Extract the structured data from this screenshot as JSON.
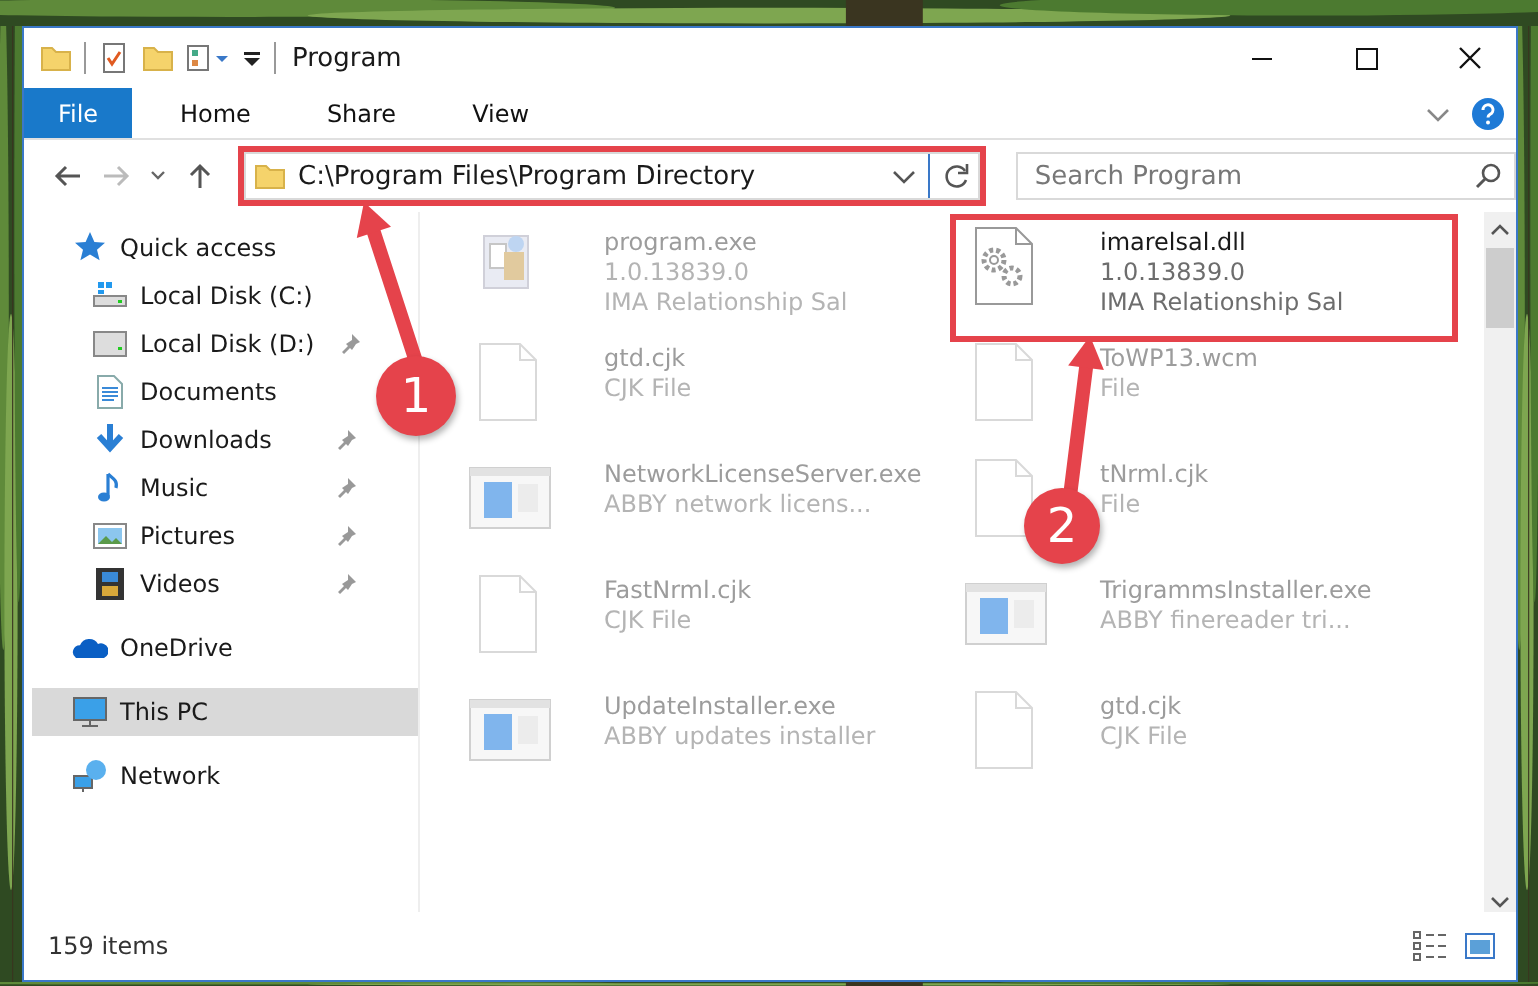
{
  "window": {
    "title": "Program"
  },
  "ribbon": {
    "tabs": [
      {
        "label": "File",
        "kind": "file",
        "selected": false
      },
      {
        "label": "Home",
        "kind": "tab",
        "selected": false
      },
      {
        "label": "Share",
        "kind": "tab",
        "selected": false
      },
      {
        "label": "View",
        "kind": "tab",
        "selected": false
      }
    ]
  },
  "address_bar": {
    "path": "C:\\Program Files\\Program Directory",
    "highlighted": true
  },
  "search": {
    "placeholder": "Search Program"
  },
  "nav_pane": {
    "items": [
      {
        "label": "Quick access",
        "selected": false,
        "children": [
          {
            "label": "Local Disk (C:)",
            "pinned": false
          },
          {
            "label": "Local Disk (D:)",
            "pinned": true
          },
          {
            "label": "Documents",
            "pinned": false
          },
          {
            "label": "Downloads",
            "pinned": true
          },
          {
            "label": "Music",
            "pinned": true
          },
          {
            "label": "Pictures",
            "pinned": true
          },
          {
            "label": "Videos",
            "pinned": true
          }
        ]
      },
      {
        "label": "OneDrive",
        "selected": false
      },
      {
        "label": "This PC",
        "selected": true
      },
      {
        "label": "Network",
        "selected": false
      }
    ]
  },
  "files": [
    {
      "name": "program.exe",
      "lines": [
        "1.0.13839.0",
        "IMA Relationship Sal"
      ],
      "kind": "installer",
      "highlighted": false
    },
    {
      "name": "imarelsal.dll",
      "lines": [
        "1.0.13839.0",
        "IMA Relationship Sal"
      ],
      "kind": "library",
      "highlighted": true
    },
    {
      "name": "gtd.cjk",
      "lines": [
        "CJK File"
      ],
      "kind": "document",
      "highlighted": false
    },
    {
      "name": "ToWP13.wcm",
      "lines": [
        "File"
      ],
      "kind": "document",
      "highlighted": false
    },
    {
      "name": "NetworkLicenseServer.exe",
      "lines": [
        "ABBY network licens..."
      ],
      "kind": "application",
      "highlighted": false
    },
    {
      "name": "tNrml.cjk",
      "lines": [
        "File"
      ],
      "kind": "document",
      "highlighted": false
    },
    {
      "name": "FastNrml.cjk",
      "lines": [
        "CJK File"
      ],
      "kind": "document",
      "highlighted": false
    },
    {
      "name": "TrigrammsInstaller.exe",
      "lines": [
        "ABBY finereader tri..."
      ],
      "kind": "application",
      "highlighted": false
    },
    {
      "name": "UpdateInstaller.exe",
      "lines": [
        "ABBY updates installer"
      ],
      "kind": "application",
      "highlighted": false
    },
    {
      "name": "gtd.cjk",
      "lines": [
        "CJK File"
      ],
      "kind": "document",
      "highlighted": false
    }
  ],
  "callouts": [
    {
      "number": "1"
    },
    {
      "number": "2"
    }
  ],
  "status_bar": {
    "item_count": "159 items"
  }
}
